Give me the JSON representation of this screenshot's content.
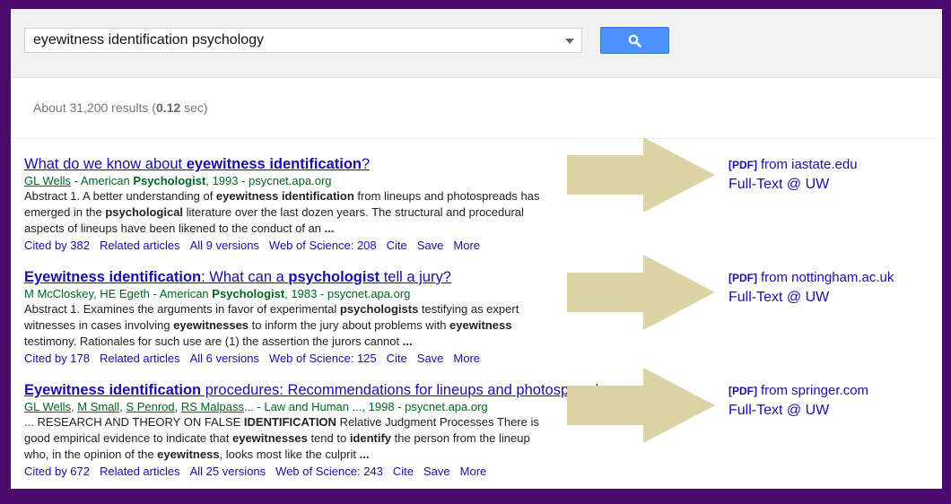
{
  "search": {
    "query": "eyewitness identification psychology"
  },
  "stats": {
    "prefix": "About 31,200 results (",
    "time": "0.12",
    "suffix": " sec)"
  },
  "results": [
    {
      "title_parts": [
        [
          "What do we know about ",
          false
        ],
        [
          "eyewitness identification",
          true
        ],
        [
          "?",
          false
        ]
      ],
      "meta_parts": [
        [
          "GL Wells",
          "author"
        ],
        [
          " - American ",
          "text"
        ],
        [
          "Psychologist",
          "bold"
        ],
        [
          ", 1993 - psycnet.apa.org",
          "text"
        ]
      ],
      "snippet_parts": [
        [
          "Abstract 1. A better understanding of ",
          false
        ],
        [
          "eyewitness identification",
          true
        ],
        [
          " from lineups and photospreads has emerged in the ",
          false
        ],
        [
          "psychological",
          true
        ],
        [
          " literature over the last dozen years. The structural and procedural aspects of lineups have been likened to the conduct of an ",
          false
        ],
        [
          "...",
          true
        ]
      ],
      "links": [
        "Cited by 382",
        "Related articles",
        "All 9 versions",
        "Web of Science: 208",
        "Cite",
        "Save",
        "More"
      ],
      "pdf_tag": "[PDF]",
      "pdf_source": "from iastate.edu",
      "fulltext": "Full-Text @ UW"
    },
    {
      "title_parts": [
        [
          "Eyewitness identification",
          true
        ],
        [
          ": What can a ",
          false
        ],
        [
          "psychologist",
          true
        ],
        [
          " tell a jury?",
          false
        ]
      ],
      "meta_parts": [
        [
          "M McCloskey, HE Egeth",
          "text"
        ],
        [
          " - American ",
          "text"
        ],
        [
          "Psychologist",
          "bold"
        ],
        [
          ", 1983 - psycnet.apa.org",
          "text"
        ]
      ],
      "snippet_parts": [
        [
          "Abstract 1. Examines the arguments in favor of experimental ",
          false
        ],
        [
          "psychologists",
          true
        ],
        [
          " testifying as expert witnesses in cases involving ",
          false
        ],
        [
          "eyewitnesses",
          true
        ],
        [
          " to inform the jury about problems with ",
          false
        ],
        [
          "eyewitness",
          true
        ],
        [
          " testimony. Rationales for such use are (1) the assertion the jurors cannot ",
          false
        ],
        [
          "...",
          true
        ]
      ],
      "links": [
        "Cited by 178",
        "Related articles",
        "All 6 versions",
        "Web of Science: 125",
        "Cite",
        "Save",
        "More"
      ],
      "pdf_tag": "[PDF]",
      "pdf_source": "from nottingham.ac.uk",
      "fulltext": "Full-Text @ UW"
    },
    {
      "title_parts": [
        [
          "Eyewitness identification",
          true
        ],
        [
          " procedures: Recommendations for lineups and photospreads",
          false
        ]
      ],
      "meta_parts": [
        [
          "GL Wells",
          "author"
        ],
        [
          ", ",
          "text"
        ],
        [
          "M Small",
          "author"
        ],
        [
          ", ",
          "text"
        ],
        [
          "S Penrod",
          "author"
        ],
        [
          ", ",
          "text"
        ],
        [
          "RS Malpass",
          "author"
        ],
        [
          "... - Law and Human ..., 1998 - psycnet.apa.org",
          "text"
        ]
      ],
      "snippet_parts": [
        [
          "... RESEARCH AND THEORY ON FALSE ",
          false
        ],
        [
          "IDENTIFICATION",
          true
        ],
        [
          " Relative Judgment Processes There is good empirical evidence to indicate that ",
          false
        ],
        [
          "eyewitnesses",
          true
        ],
        [
          " tend to ",
          false
        ],
        [
          "identify",
          true
        ],
        [
          " the person from the lineup who, in the opinion of the ",
          false
        ],
        [
          "eyewitness",
          true
        ],
        [
          ", looks most like the culprit ",
          false
        ],
        [
          "...",
          true
        ]
      ],
      "links": [
        "Cited by 672",
        "Related articles",
        "All 25 versions",
        "Web of Science: 243",
        "Cite",
        "Save",
        "More"
      ],
      "pdf_tag": "[PDF]",
      "pdf_source": "from springer.com",
      "fulltext": "Full-Text @ UW"
    }
  ],
  "colors": {
    "frame_border": "#4b0a6e",
    "link": "#1a0dab",
    "meta": "#006621",
    "arrow": "#dcd4a4",
    "button": "#4d90fe"
  }
}
